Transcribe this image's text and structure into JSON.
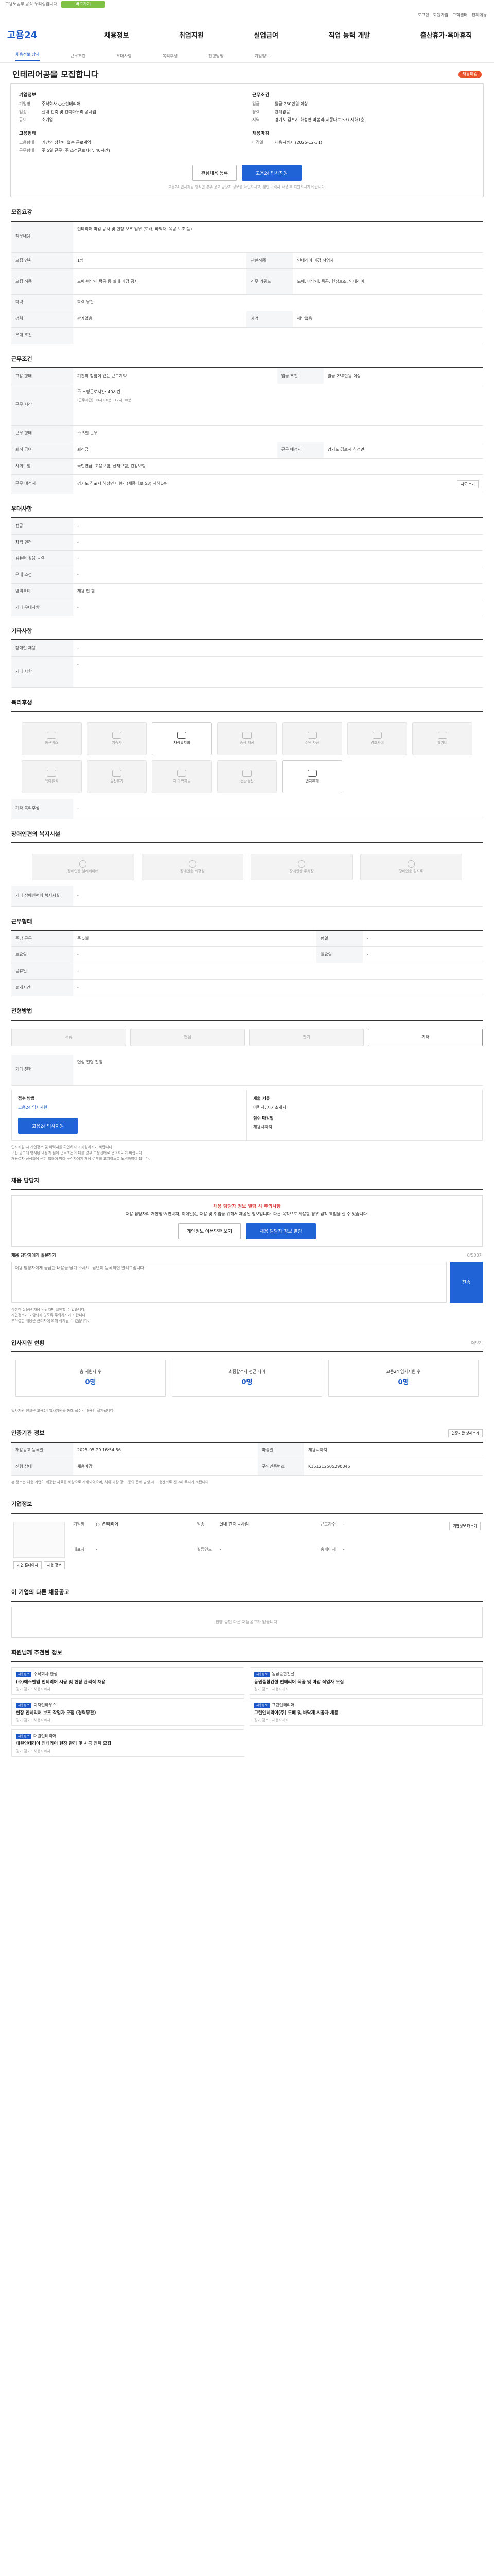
{
  "topbar": {
    "text": "고용노동부 공식 누리집입니다",
    "pill": "바로가기"
  },
  "util": {
    "links": [
      "로그인",
      "회원가입",
      "고객센터",
      "전체메뉴"
    ]
  },
  "header": {
    "logo": "고용24",
    "nav": [
      "채용정보",
      "취업지원",
      "실업급여",
      "직업 능력 개발",
      "출산휴가·육아휴직"
    ]
  },
  "subnav": [
    "채용정보 상세",
    "근무조건",
    "우대사항",
    "복리후생",
    "전형방법",
    "기업정보"
  ],
  "job": {
    "title": "인테리어공을 모집합니다",
    "badge": "채용마감",
    "company_h": "기업정보",
    "company": [
      {
        "k": "기업명",
        "v": "주식회사 ○○인테리어"
      },
      {
        "k": "업종",
        "v": "실내 건축 및 건축마무리 공사업"
      },
      {
        "k": "규모",
        "v": "소기업"
      }
    ],
    "cond_h": "근무조건",
    "cond": [
      {
        "k": "임금",
        "v": "월급 250만원 이상"
      },
      {
        "k": "경력",
        "v": "관계없음"
      },
      {
        "k": "지역",
        "v": "경기도 김포시 하성면 마봉리(세종대로 53) 지하1층"
      }
    ],
    "emp_h": "고용형태",
    "emp": [
      {
        "k": "고용형태",
        "v": "기간의 정함이 없는 근로계약"
      },
      {
        "k": "근무형태",
        "v": "주 5일 근무 (주 소정근로시간: 40시간)"
      }
    ],
    "deadline_h": "채용마감",
    "deadline": [
      {
        "k": "마감일",
        "v": "채용시까지 (2025-12-31)"
      }
    ],
    "btn_scrap": "관심채용 등록",
    "btn_apply": "고용24 입사지원",
    "note": "고용24 입사지원 방식인 경우 공고 담당자 정보를 확인하시고, 본인 이력서 작성 후 지원하시기 바랍니다."
  },
  "recruit": {
    "heading": "모집요강",
    "duty_label": "직무내용",
    "duty": "인테리어 마감 공사 및 현장 보조 업무 (도배, 바닥재, 목공 보조 등)",
    "rows": [
      {
        "k": "모집 인원",
        "v": "1명",
        "k2": "관련직종",
        "v2": "인테리어 마감 작업자"
      },
      {
        "k": "모집 직종",
        "v": "도배·바닥재·목공 등 실내 마감 공사",
        "k2": "직무 키워드",
        "v2": "도배, 바닥재, 목공, 현장보조, 인테리어"
      },
      {
        "k": "학력",
        "v": "학력 무관",
        "k2": "",
        "v2": ""
      },
      {
        "k": "경력",
        "v": "관계없음",
        "k2": "자격",
        "v2": "해당없음"
      },
      {
        "k": "우대 조건",
        "v": "",
        "k2": "",
        "v2": ""
      }
    ]
  },
  "workcond": {
    "heading": "근무조건",
    "rows": [
      {
        "k": "고용 형태",
        "v": "기간의 정함이 없는 근로계약",
        "k2": "임금 조건",
        "v2": "월급 250만원 이상"
      },
      {
        "k": "근무 시간",
        "v": "주 소정근로시간: 40시간",
        "k2": "",
        "v2": ""
      },
      {
        "k": "근무 형태",
        "v": "주 5일 근무",
        "k2": "",
        "v2": ""
      },
      {
        "k": "퇴직 급여",
        "v": "퇴직금",
        "k2": "근무 예정지",
        "v2": "경기도 김포시 하성면"
      },
      {
        "k": "사회보험",
        "v": "국민연금, 고용보험, 산재보험, 건강보험",
        "k2": "",
        "v2": ""
      },
      {
        "k": "근무 예정지",
        "v": "경기도 김포시 하성면 마봉리(세종대로 53) 지하1층",
        "k2": "",
        "v2": ""
      }
    ],
    "worktime": "(근무시간) 08시 00분~17시 00분",
    "map_btn": "지도 보기"
  },
  "prefer": {
    "heading": "우대사항",
    "rows": [
      {
        "k": "전공",
        "v": "-"
      },
      {
        "k": "자격 면허",
        "v": "-"
      },
      {
        "k": "컴퓨터 활용 능력",
        "v": "-"
      },
      {
        "k": "우대 조건",
        "v": "-"
      },
      {
        "k": "병역특례",
        "v": "채용 안 함"
      },
      {
        "k": "기타 우대사항",
        "v": "-"
      }
    ]
  },
  "other": {
    "heading": "기타사항",
    "rows": [
      {
        "k": "장애인 채용",
        "v": "-"
      },
      {
        "k": "기타 사항",
        "v": "-"
      }
    ]
  },
  "welfare": {
    "heading": "복리후생",
    "items": [
      {
        "label": "통근버스",
        "icon": "bus-icon",
        "on": false
      },
      {
        "label": "기숙사",
        "icon": "dormitory-icon",
        "on": false
      },
      {
        "label": "차량유지비",
        "icon": "car-icon",
        "on": true
      },
      {
        "label": "중식 제공",
        "icon": "meal-icon",
        "on": false
      },
      {
        "label": "주택 자금",
        "icon": "house-icon",
        "on": false
      },
      {
        "label": "경조사비",
        "icon": "gift-icon",
        "on": false
      },
      {
        "label": "휴가비",
        "icon": "vacation-icon",
        "on": false
      },
      {
        "label": "육아휴직",
        "icon": "baby-icon",
        "on": false
      },
      {
        "label": "출산휴가",
        "icon": "maternity-icon",
        "on": false
      },
      {
        "label": "자녀 학자금",
        "icon": "school-icon",
        "on": false
      },
      {
        "label": "건강검진",
        "icon": "health-icon",
        "on": false
      },
      {
        "label": "연차휴가",
        "icon": "calendar-icon",
        "on": true
      }
    ],
    "etc_label": "기타 복리후생",
    "etc_value": "-"
  },
  "disability": {
    "heading": "장애인편의 복지시설",
    "items": [
      "장애인용 엘리베이터",
      "장애인용 화장실",
      "장애인용 주차장",
      "장애인용 경사로"
    ],
    "etc_label": "기타 장애인편의 복지시설",
    "etc_value": "-"
  },
  "hours": {
    "heading": "근무형태",
    "rows": [
      {
        "k": "주당 근무",
        "v": "주 5일",
        "k2": "평일",
        "v2": "-"
      },
      {
        "k": "토요일",
        "v": "-",
        "k2": "일요일",
        "v2": "-"
      },
      {
        "k": "공휴일",
        "v": "-",
        "k2": "",
        "v2": ""
      },
      {
        "k": "휴게시간",
        "v": "-",
        "k2": "",
        "v2": ""
      }
    ]
  },
  "process": {
    "heading": "전형방법",
    "methods": [
      "서류",
      "면접",
      "필기",
      "기타"
    ],
    "active": 3,
    "etc_label": "기타 전형",
    "etc_value": "면접 전형 진행",
    "apply_h": "접수 방법",
    "apply_v": "고용24 입사지원",
    "docs_h": "제출 서류",
    "docs_v": "이력서, 자기소개서",
    "apply_btn": "고용24 입사지원",
    "deadline_h": "접수 마감일",
    "deadline_v": "채용시까지",
    "bullets": [
      "입사지원 시 개인정보 및 이력서를 확인하시고 지원하시기 바랍니다.",
      "모집 공고에 명시된 내용과 실제 근로조건이 다를 경우 고용센터로 문의하시기 바랍니다.",
      "채용절차 공정화에 관한 법률에 따라 구직자에게 채용 여부를 고지하도록 노력하여야 합니다."
    ]
  },
  "manager": {
    "heading": "채용 담당자",
    "alert_title": "채용 담당자 정보 열람 시 주의사항",
    "alert_body": "채용 담당자의 개인정보(연락처, 이메일)는 채용 및 취업을 위해서 제공된 정보입니다. 다른 목적으로 사용할 경우 법적 책임을 질 수 있습니다.",
    "btn_terms": "개인정보 이용약관 보기",
    "btn_view": "채용 담당자 정보 열람",
    "inquiry_label": "채용 담당자에게 질문하기",
    "inquiry_placeholder": "채용 담당자에게 궁금한 내용을 남겨 주세요. 답변이 등록되면 알려드립니다.",
    "inquiry_btn": "전송",
    "inquiry_count": "0/500자",
    "notes": [
      "작성한 질문은 채용 담당자만 확인할 수 있습니다.",
      "개인정보가 포함되지 않도록 주의하시기 바랍니다.",
      "부적절한 내용은 관리자에 의해 삭제될 수 있습니다."
    ]
  },
  "stats": {
    "heading": "입사지원 현황",
    "more": "더보기",
    "items": [
      {
        "label": "총 지원자 수",
        "value": "0명"
      },
      {
        "label": "최종합격자 평균 나이",
        "value": "0명"
      },
      {
        "label": "고용24 입사지원 수",
        "value": "0명"
      }
    ],
    "note": "입사지원 현황은 고용24 입사지원을 통해 접수된 내용만 집계됩니다."
  },
  "info": {
    "heading": "인증기관 정보",
    "btn": "인증기관 상세보기",
    "rows": [
      {
        "k": "채용공고 등록일",
        "v": "2025-05-29 16:54:56",
        "k2": "마감일",
        "v2": "채용시까지"
      },
      {
        "k": "진행 상태",
        "v": "채용마감",
        "k2": "구인인증번호",
        "v2": "K151212505290045"
      }
    ],
    "warn": "본 정보는 채용 기업이 제공한 자료를 바탕으로 게재되었으며, 허위·과장 광고 등의 문제 발생 시 고용센터로 신고해 주시기 바랍니다."
  },
  "company": {
    "heading": "기업정보",
    "btn": "기업정보 더보기",
    "rows": [
      {
        "k": "기업명",
        "v": "○○인테리어"
      },
      {
        "k": "업종",
        "v": "실내 건축 공사업"
      },
      {
        "k": "근로자수",
        "v": "-"
      },
      {
        "k": "대표자",
        "v": "-"
      },
      {
        "k": "설립연도",
        "v": "-"
      },
      {
        "k": "홈페이지",
        "v": "-"
      }
    ],
    "links": [
      "기업 홈페이지",
      "채용 정보"
    ]
  },
  "other_jobs": {
    "heading": "이 기업의 다른 채용공고",
    "empty": "진행 중인 다른 채용공고가 없습니다."
  },
  "recommend": {
    "heading": "회원님께 추천된 정보",
    "items": [
      {
        "tag": "채용정보",
        "company": "주식회사 한샘",
        "title": "(주)에스앤엠 인테리어 시공 및 현장 관리직 채용",
        "meta": "경기 김포 · 채용시까지"
      },
      {
        "tag": "채용정보",
        "company": "동남종합건설",
        "title": "동원종합건설 인테리어 목공 및 마감 작업자 모집",
        "meta": "경기 김포 · 채용시까지"
      },
      {
        "tag": "채용정보",
        "company": "디자인하우스",
        "title": "현장 인테리어 보조 작업자 모집 (경력무관)",
        "meta": "경기 김포 · 채용시까지"
      },
      {
        "tag": "채용정보",
        "company": "그린인테리어",
        "title": "그린인테리어(주) 도배 및 바닥재 시공자 채용",
        "meta": "경기 김포 · 채용시까지"
      },
      {
        "tag": "채용정보",
        "company": "대원인테리어",
        "title": "대원인테리어 인테리어 현장 관리 및 시공 인력 모집",
        "meta": "경기 김포 · 채용시까지"
      }
    ]
  }
}
